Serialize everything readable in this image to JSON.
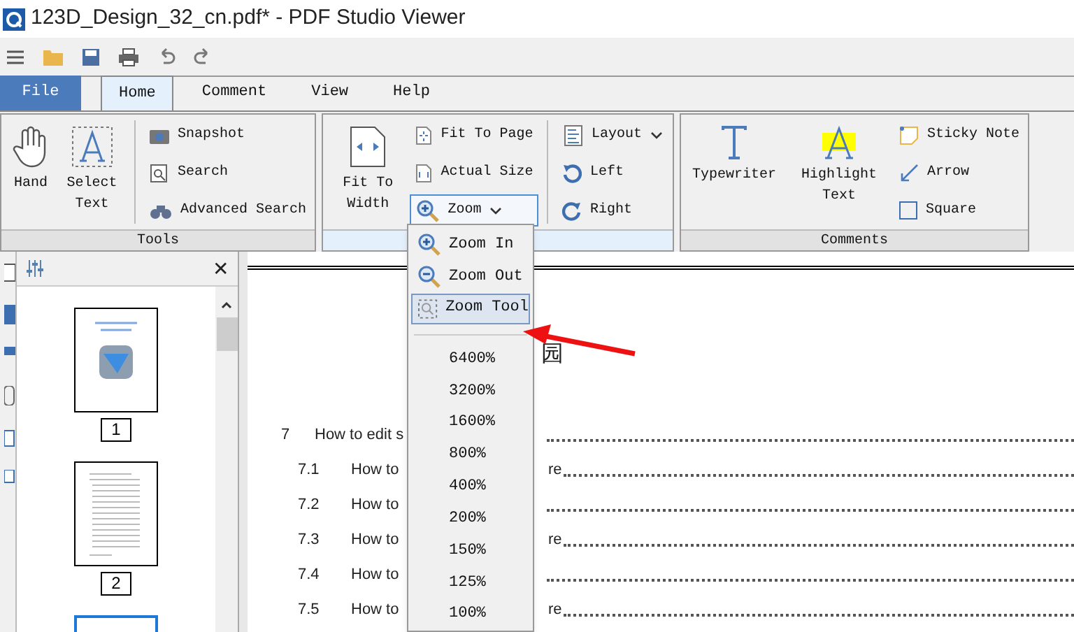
{
  "window": {
    "title": "123D_Design_32_cn.pdf* - PDF Studio Viewer"
  },
  "tabs": [
    {
      "label": "File",
      "kind": "file",
      "selected": false
    },
    {
      "label": "Home",
      "kind": "tab",
      "selected": true
    },
    {
      "label": "Comment",
      "kind": "tab",
      "selected": false
    },
    {
      "label": "View",
      "kind": "tab",
      "selected": false
    },
    {
      "label": "Help",
      "kind": "tab",
      "selected": false
    }
  ],
  "ribbon": {
    "groups": [
      {
        "title": "Tools",
        "items": [
          {
            "label": "Hand",
            "kind": "large"
          },
          {
            "label": "Select Text",
            "kind": "large"
          },
          {
            "kind": "divider"
          },
          {
            "kind": "column",
            "items": [
              {
                "label": "Snapshot"
              },
              {
                "label": "Search"
              },
              {
                "label": "Advanced Search"
              }
            ]
          }
        ]
      },
      {
        "items": [
          {
            "label": "Fit To Width",
            "kind": "large"
          },
          {
            "kind": "column",
            "items": [
              {
                "label": "Fit To Page"
              },
              {
                "label": "Actual Size"
              },
              {
                "label": "Zoom",
                "dropdown": true,
                "open": true
              }
            ]
          },
          {
            "kind": "divider"
          },
          {
            "kind": "column",
            "items": [
              {
                "label": "Layout",
                "dropdown": true,
                "open": false
              },
              {
                "label": "Left"
              },
              {
                "label": "Right"
              }
            ]
          }
        ]
      },
      {
        "title": "Comments",
        "items": [
          {
            "label": "Typewriter",
            "kind": "large"
          },
          {
            "label": "Highlight Text",
            "kind": "large"
          },
          {
            "kind": "column",
            "items": [
              {
                "label": "Sticky Note"
              },
              {
                "label": "Arrow"
              },
              {
                "label": "Square"
              }
            ]
          }
        ]
      }
    ]
  },
  "thumbnails": {
    "close": "✕",
    "pages": [
      {
        "label": "1",
        "selected": false
      },
      {
        "label": "2",
        "selected": false
      },
      {
        "selected": true
      }
    ]
  },
  "document": {
    "heading": "园",
    "toc": [
      {
        "number": "7",
        "text": "How to edit s"
      },
      {
        "number": "7.1",
        "text": "How to",
        "text_after": "re"
      },
      {
        "number": "7.2",
        "text": "How to"
      },
      {
        "number": "7.3",
        "text": "How to",
        "text_after": "re"
      },
      {
        "number": "7.4",
        "text": "How to"
      },
      {
        "number": "7.5",
        "text": "How to",
        "text_after": "re"
      }
    ]
  },
  "zoom_menu": {
    "items": [
      {
        "label": "Zoom In",
        "kind": "command",
        "selected": false
      },
      {
        "label": "Zoom Out",
        "kind": "command",
        "selected": false
      },
      {
        "label": "Zoom Tool",
        "kind": "command",
        "selected": true
      },
      {
        "kind": "separator"
      },
      {
        "label": "6400%",
        "kind": "level",
        "selected": false
      },
      {
        "label": "3200%",
        "kind": "level",
        "selected": false
      },
      {
        "label": "1600%",
        "kind": "level",
        "selected": false
      },
      {
        "label": "800%",
        "kind": "level",
        "selected": false
      },
      {
        "label": "400%",
        "kind": "level",
        "selected": false
      },
      {
        "label": "200%",
        "kind": "level",
        "selected": false
      },
      {
        "label": "150%",
        "kind": "level",
        "selected": false
      },
      {
        "label": "125%",
        "kind": "level",
        "selected": false
      },
      {
        "label": "100%",
        "kind": "level",
        "selected": false
      }
    ]
  }
}
